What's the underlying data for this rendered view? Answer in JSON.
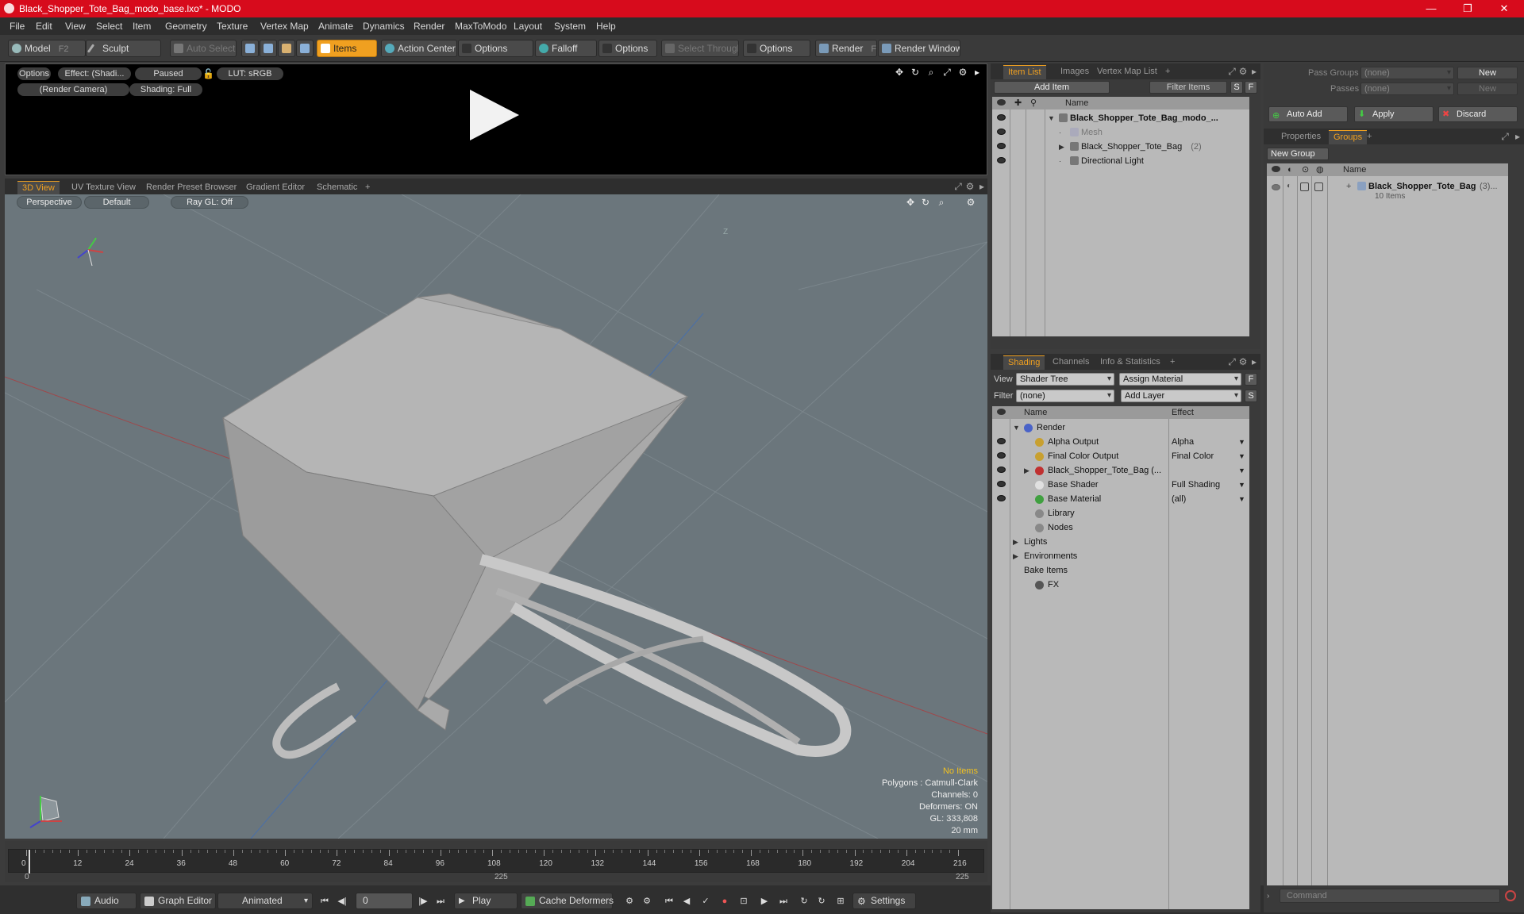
{
  "window": {
    "title": "Black_Shopper_Tote_Bag_modo_base.lxo* - MODO",
    "minimize": "—",
    "maximize": "❐",
    "close": "✕"
  },
  "menu": [
    "File",
    "Edit",
    "View",
    "Select",
    "Item",
    "Geometry",
    "Texture",
    "Vertex Map",
    "Animate",
    "Dynamics",
    "Render",
    "MaxToModo",
    "Layout",
    "System",
    "Help"
  ],
  "toolbar": {
    "model": "Model",
    "model_key": "F2",
    "sculpt": "Sculpt",
    "auto_select": "Auto Select",
    "items": "Items",
    "action_center": "Action Center",
    "options1": "Options",
    "falloff": "Falloff",
    "options2": "Options",
    "select_through": "Select Through",
    "options3": "Options",
    "render": "Render",
    "render_key": "F9",
    "render_window": "Render Window"
  },
  "preview": {
    "options": "Options",
    "effect": "Effect: (Shadi...",
    "paused": "Paused",
    "lut": "LUT: sRGB",
    "camera": "(Render Camera)",
    "shading": "Shading: Full"
  },
  "viewport_tabs": [
    "3D View",
    "UV Texture View",
    "Render Preset Browser",
    "Gradient Editor",
    "Schematic",
    "+"
  ],
  "viewport": {
    "perspective": "Perspective",
    "default": "Default",
    "raygl": "Ray GL: Off",
    "axis_label": "Z",
    "stats": {
      "no_items": "No Items",
      "polygons": "Polygons : Catmull-Clark",
      "channels": "Channels: 0",
      "deformers": "Deformers: ON",
      "gl": "GL: 333,808",
      "scale": "20 mm"
    }
  },
  "timeline": {
    "ticks": [
      "0",
      "12",
      "24",
      "36",
      "48",
      "60",
      "72",
      "84",
      "96",
      "108",
      "120",
      "132",
      "144",
      "156",
      "168",
      "180",
      "192",
      "204",
      "216"
    ],
    "start": "0",
    "mid": "225",
    "end": "225"
  },
  "bottombar": {
    "audio": "Audio",
    "graph_editor": "Graph Editor",
    "animated": "Animated",
    "frame": "0",
    "play": "Play",
    "cache": "Cache Deformers",
    "settings": "Settings"
  },
  "item_list": {
    "tabs": [
      "Item List",
      "Images",
      "Vertex Map List",
      "+"
    ],
    "add_item": "Add Item",
    "filter_items": "Filter Items",
    "s": "S",
    "f": "F",
    "col_name": "Name",
    "rows": [
      {
        "label": "Black_Shopper_Tote_Bag_modo_...",
        "indent": 0,
        "expand": "▼",
        "bold": true
      },
      {
        "label": "Mesh",
        "indent": 1,
        "expand": "",
        "bold": false,
        "dim": true
      },
      {
        "label": "Black_Shopper_Tote_Bag",
        "suffix": "(2)",
        "indent": 1,
        "expand": "▶",
        "bold": false
      },
      {
        "label": "Directional Light",
        "indent": 1,
        "expand": "",
        "bold": false
      }
    ]
  },
  "shading": {
    "tabs": [
      "Shading",
      "Channels",
      "Info & Statistics",
      "+"
    ],
    "view_label": "View",
    "view_value": "Shader Tree",
    "assign_material": "Assign Material",
    "filter_label": "Filter",
    "filter_value": "(none)",
    "add_layer": "Add Layer",
    "f": "F",
    "s": "S",
    "col_name": "Name",
    "col_effect": "Effect",
    "rows": [
      {
        "label": "Render",
        "effect": "",
        "indent": 0,
        "expand": "▼",
        "eye": false,
        "color": "#4a63c8"
      },
      {
        "label": "Alpha Output",
        "effect": "Alpha",
        "indent": 1,
        "expand": "",
        "eye": true,
        "color": "#c8a030"
      },
      {
        "label": "Final Color Output",
        "effect": "Final Color",
        "indent": 1,
        "expand": "",
        "eye": true,
        "color": "#c8a030"
      },
      {
        "label": "Black_Shopper_Tote_Bag (...",
        "effect": "",
        "indent": 1,
        "expand": "▶",
        "eye": true,
        "color": "#c03030"
      },
      {
        "label": "Base Shader",
        "effect": "Full Shading",
        "indent": 1,
        "expand": "",
        "eye": true,
        "color": "#e0e0e0"
      },
      {
        "label": "Base Material",
        "effect": "(all)",
        "indent": 1,
        "expand": "",
        "eye": true,
        "color": "#40a040"
      },
      {
        "label": "Library",
        "effect": "",
        "indent": 1,
        "expand": "",
        "eye": false,
        "color": "#888"
      },
      {
        "label": "Nodes",
        "effect": "",
        "indent": 1,
        "expand": "",
        "eye": false,
        "color": "#888"
      },
      {
        "label": "Lights",
        "effect": "",
        "indent": 0,
        "expand": "▶",
        "eye": false,
        "color": ""
      },
      {
        "label": "Environments",
        "effect": "",
        "indent": 0,
        "expand": "▶",
        "eye": false,
        "color": ""
      },
      {
        "label": "Bake Items",
        "effect": "",
        "indent": 0,
        "expand": "",
        "eye": false,
        "color": ""
      },
      {
        "label": "FX",
        "effect": "",
        "indent": 1,
        "expand": "",
        "eye": false,
        "color": "#555"
      }
    ]
  },
  "right_panel": {
    "pass_groups_label": "Pass Groups",
    "pass_groups_value": "(none)",
    "new": "New",
    "passes_label": "Passes",
    "passes_value": "(none)",
    "new2": "New",
    "auto_add": "Auto Add",
    "apply": "Apply",
    "discard": "Discard",
    "tabs": [
      "Properties",
      "Groups",
      "+"
    ],
    "new_group": "New Group",
    "col_name": "Name",
    "group_name": "Black_Shopper_Tote_Bag",
    "group_count": "(3)...",
    "group_items": "10 Items",
    "command_placeholder": "Command"
  }
}
